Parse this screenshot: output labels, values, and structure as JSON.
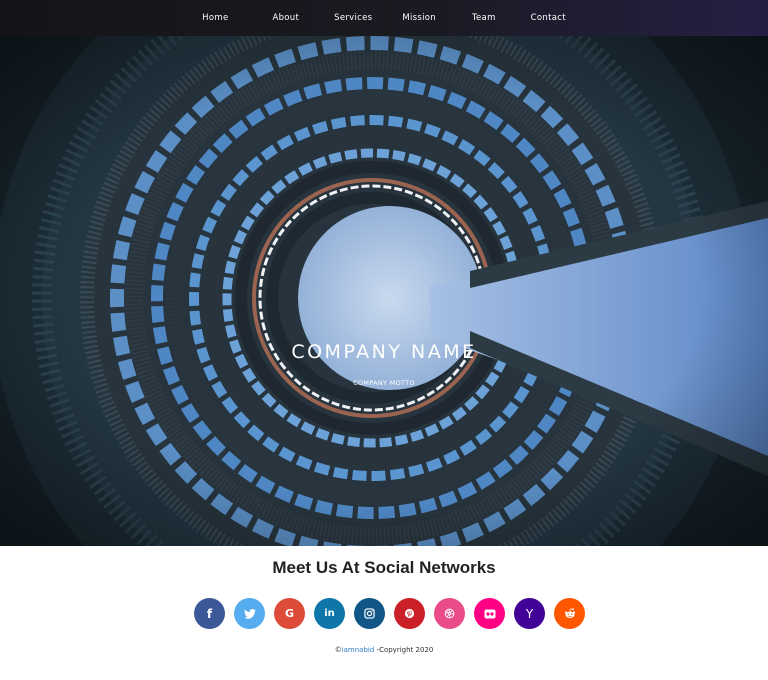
{
  "nav": {
    "items": [
      {
        "label": "Home"
      },
      {
        "label": "About"
      },
      {
        "label": "Services"
      },
      {
        "label": "Mission"
      },
      {
        "label": "Team"
      },
      {
        "label": "Contact"
      }
    ]
  },
  "hero": {
    "title": "COMPANY NAME",
    "motto": "COMPANY MOTTO"
  },
  "social": {
    "heading": "Meet Us At Social Networks",
    "buttons": [
      {
        "icon": "facebook-icon",
        "glyph": "f",
        "color": "#3b5998"
      },
      {
        "icon": "twitter-icon",
        "glyph": "",
        "color": "#55acee"
      },
      {
        "icon": "google-plus-icon",
        "glyph": "G",
        "color": "#dd4b39"
      },
      {
        "icon": "linkedin-icon",
        "glyph": "in",
        "color": "#0e76a8"
      },
      {
        "icon": "instagram-icon",
        "glyph": "",
        "color": "#125688"
      },
      {
        "icon": "pinterest-icon",
        "glyph": "",
        "color": "#cb2027"
      },
      {
        "icon": "dribbble-icon",
        "glyph": "",
        "color": "#ea4c89"
      },
      {
        "icon": "flickr-icon",
        "glyph": "",
        "color": "#ff0084"
      },
      {
        "icon": "yahoo-icon",
        "glyph": "Y",
        "color": "#430297"
      },
      {
        "icon": "reddit-icon",
        "glyph": "",
        "color": "#ff5700"
      }
    ]
  },
  "footer": {
    "prefix": "©",
    "author": "iamnabid",
    "suffix": " -Copyright 2020"
  }
}
